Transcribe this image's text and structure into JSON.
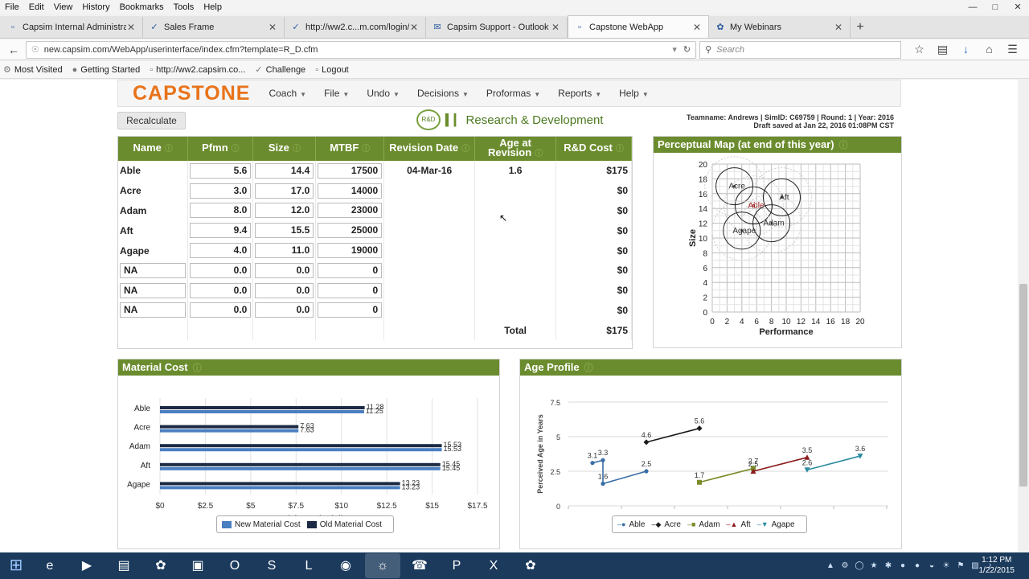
{
  "browser": {
    "menu": [
      "File",
      "Edit",
      "View",
      "History",
      "Bookmarks",
      "Tools",
      "Help"
    ],
    "tabs": [
      {
        "label": "Capsim Internal Administrator ...",
        "icon": "page-icon",
        "active": false
      },
      {
        "label": "Sales Frame",
        "icon": "capsim-icon",
        "active": false
      },
      {
        "label": "http://ww2.c...m.com/login/",
        "icon": "capsim-icon",
        "active": false
      },
      {
        "label": "Capsim Support - Outlook ...",
        "icon": "outlook-icon",
        "active": false
      },
      {
        "label": "Capstone WebApp",
        "icon": "page-icon",
        "active": true
      },
      {
        "label": "My Webinars",
        "icon": "webinar-icon",
        "active": false
      }
    ],
    "url": "new.capsim.com/WebApp/userinterface/index.cfm?template=R_D.cfm",
    "search_placeholder": "Search",
    "bookmarks": [
      "Most Visited",
      "Getting Started",
      "http://ww2.capsim.co...",
      "Challenge",
      "Logout"
    ]
  },
  "app": {
    "logo": "CAPSTONE",
    "menus": [
      "Coach",
      "File",
      "Undo",
      "Decisions",
      "Proformas",
      "Reports",
      "Help"
    ],
    "recalc_label": "Recalculate",
    "page_title": "Research & Development",
    "rd_icon_text": "R&D",
    "team_line1": "Teamname: Andrews | SimID: C69759 | Round: 1 | Year: 2016",
    "team_line2": "Draft saved at Jan 22, 2016 01:08PM CST"
  },
  "rd_table": {
    "headers": [
      "Name",
      "Pfmn",
      "Size",
      "MTBF",
      "Revision Date",
      "Age at Revision",
      "R&D Cost"
    ],
    "rows": [
      {
        "name": "Able",
        "pfmn": "5.6",
        "size": "14.4",
        "mtbf": "17500",
        "rev": "04-Mar-16",
        "age": "1.6",
        "cost": "$175",
        "editable_name": false
      },
      {
        "name": "Acre",
        "pfmn": "3.0",
        "size": "17.0",
        "mtbf": "14000",
        "rev": "",
        "age": "",
        "cost": "$0",
        "editable_name": false
      },
      {
        "name": "Adam",
        "pfmn": "8.0",
        "size": "12.0",
        "mtbf": "23000",
        "rev": "",
        "age": "",
        "cost": "$0",
        "editable_name": false
      },
      {
        "name": "Aft",
        "pfmn": "9.4",
        "size": "15.5",
        "mtbf": "25000",
        "rev": "",
        "age": "",
        "cost": "$0",
        "editable_name": false
      },
      {
        "name": "Agape",
        "pfmn": "4.0",
        "size": "11.0",
        "mtbf": "19000",
        "rev": "",
        "age": "",
        "cost": "$0",
        "editable_name": false
      },
      {
        "name": "NA",
        "pfmn": "0.0",
        "size": "0.0",
        "mtbf": "0",
        "rev": "",
        "age": "",
        "cost": "$0",
        "editable_name": true
      },
      {
        "name": "NA",
        "pfmn": "0.0",
        "size": "0.0",
        "mtbf": "0",
        "rev": "",
        "age": "",
        "cost": "$0",
        "editable_name": true
      },
      {
        "name": "NA",
        "pfmn": "0.0",
        "size": "0.0",
        "mtbf": "0",
        "rev": "",
        "age": "",
        "cost": "$0",
        "editable_name": true
      }
    ],
    "total_label": "Total",
    "total_value": "$175"
  },
  "panels": {
    "perceptual_title": "Perceptual Map (at end of this year)",
    "material_title": "Material Cost",
    "age_title": "Age Profile"
  },
  "chart_data": [
    {
      "type": "scatter",
      "xlabel": "Performance",
      "ylabel": "Size",
      "xlim": [
        0,
        20
      ],
      "ylim": [
        0,
        20
      ],
      "x_ticks": [
        0,
        2,
        4,
        6,
        8,
        10,
        12,
        14,
        16,
        18,
        20
      ],
      "y_ticks": [
        0,
        2,
        4,
        6,
        8,
        10,
        12,
        14,
        16,
        18,
        20
      ],
      "grid": true,
      "points": [
        {
          "label": "Acre",
          "x": 3.0,
          "y": 17.0,
          "color": "#333333"
        },
        {
          "label": "Able",
          "x": 5.6,
          "y": 14.4,
          "color": "#a01818"
        },
        {
          "label": "Aft",
          "x": 9.4,
          "y": 15.5,
          "color": "#333333"
        },
        {
          "label": "Adam",
          "x": 8.0,
          "y": 12.0,
          "color": "#333333"
        },
        {
          "label": "Agape",
          "x": 4.0,
          "y": 11.0,
          "color": "#333333"
        }
      ],
      "circle_radius": 2.5
    },
    {
      "type": "bar",
      "orientation": "horizontal",
      "categories": [
        "Able",
        "Acre",
        "Adam",
        "Aft",
        "Agape"
      ],
      "series": [
        {
          "name": "Old Material Cost",
          "values": [
            11.28,
            7.63,
            15.53,
            15.45,
            13.23
          ],
          "color": "#1c2a44"
        },
        {
          "name": "New Material Cost",
          "values": [
            11.25,
            7.63,
            15.53,
            15.45,
            13.23
          ],
          "color": "#4a7fc1"
        }
      ],
      "x_ticks": [
        "$0",
        "$2.5",
        "$5",
        "$7.5",
        "$10",
        "$12.5",
        "$15",
        "$17.5"
      ],
      "xlim": [
        0,
        17.5
      ],
      "xlabel": "Material Cost in dollars",
      "legend": [
        {
          "name": "New Material Cost",
          "color": "#4a7fc1"
        },
        {
          "name": "Old Material Cost",
          "color": "#1c2a44"
        }
      ]
    },
    {
      "type": "line",
      "ylabel": "Perceived Age in Years",
      "ylim": [
        0,
        7.5
      ],
      "y_ticks": [
        "0",
        "2.5",
        "5",
        "7.5"
      ],
      "series": [
        {
          "name": "Able",
          "color": "#3a6ea5",
          "marker": "circle",
          "points": [
            [
              0.0,
              3.1
            ],
            [
              0.13,
              3.3
            ],
            [
              0.13,
              1.6
            ],
            [
              0.67,
              2.5
            ]
          ],
          "labels": [
            "3.1",
            "3.3",
            "1.6",
            "2.5"
          ]
        },
        {
          "name": "Acre",
          "color": "#1a1a1a",
          "marker": "diamond",
          "points": [
            [
              0.67,
              4.6
            ],
            [
              1.33,
              5.6
            ]
          ],
          "labels": [
            "4.6",
            "5.6"
          ]
        },
        {
          "name": "Adam",
          "color": "#7a8c2a",
          "marker": "square",
          "points": [
            [
              1.33,
              1.7
            ],
            [
              2.0,
              2.7
            ]
          ],
          "labels": [
            "1.7",
            "2.7"
          ]
        },
        {
          "name": "Aft",
          "color": "#8b1a1a",
          "marker": "triangle",
          "points": [
            [
              2.0,
              2.5
            ],
            [
              2.67,
              3.5
            ]
          ],
          "labels": [
            "2.5",
            "3.5"
          ]
        },
        {
          "name": "Agape",
          "color": "#2a8ca0",
          "marker": "triangle-down",
          "points": [
            [
              2.67,
              2.6
            ],
            [
              3.33,
              3.6
            ]
          ],
          "labels": [
            "2.6",
            "3.6"
          ]
        }
      ]
    }
  ],
  "taskbar": {
    "apps": [
      "start",
      "ie",
      "media",
      "explorer",
      "flower",
      "network",
      "outlook",
      "skype",
      "lync",
      "chrome",
      "firefox",
      "phone",
      "powerpoint",
      "excel",
      "capsim"
    ],
    "time": "1:12 PM",
    "date": "1/22/2015"
  }
}
